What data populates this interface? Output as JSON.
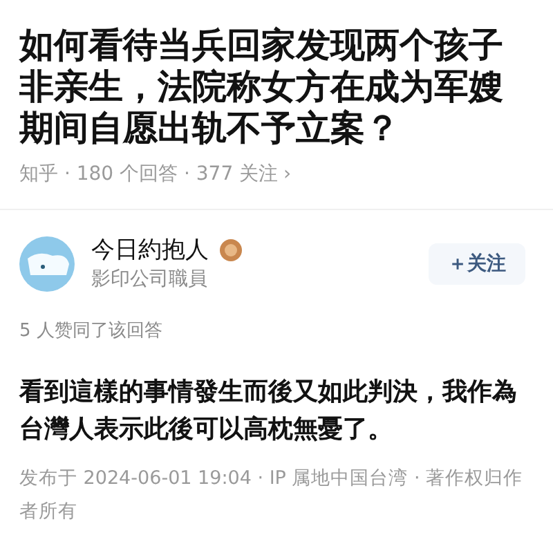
{
  "question": {
    "title": "如何看待当兵回家发现两个孩子非亲生，法院称女方在成为军嫂期间自愿出轨不予立案？",
    "meta": "知乎 · 180 个回答 · 377 关注",
    "chevron": "›"
  },
  "author": {
    "name": "今日約抱人",
    "bio": "影印公司職員",
    "follow": "＋关注"
  },
  "answer": {
    "upvotes": "5 人赞同了该回答",
    "text": "看到這樣的事情發生而後又如此判決，我作為台灣人表示此後可以高枕無憂了。",
    "footer": "发布于 2024-06-01 19:04 · IP 属地中国台湾 · 著作权归作者所有"
  }
}
